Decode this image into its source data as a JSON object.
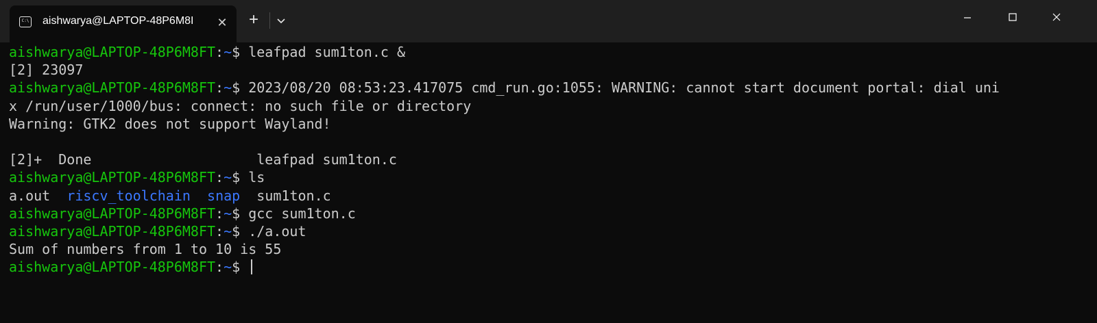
{
  "window": {
    "tab_title": "aishwarya@LAPTOP-48P6M8I",
    "tab_icon": "terminal-icon",
    "new_tab_icon": "plus-icon",
    "dropdown_icon": "chevron-down-icon",
    "minimize_icon": "minimize-icon",
    "maximize_icon": "maximize-icon",
    "close_icon": "close-icon"
  },
  "colors": {
    "background": "#0c0c0c",
    "titlebar": "#1f1f1f",
    "prompt_user": "#16c60c",
    "prompt_path": "#3b78ff",
    "text": "#cccccc"
  },
  "terminal": {
    "prompt": {
      "user": "aishwarya@LAPTOP-48P6M8FT",
      "colon": ":",
      "path": "~",
      "symbol": "$ "
    },
    "lines": {
      "l1_cmd": "leafpad sum1ton.c &",
      "l2": "[2] 23097",
      "l3_cmd": "2023/08/20 08:53:23.417075 cmd_run.go:1055: WARNING: cannot start document portal: dial uni",
      "l4": "x /run/user/1000/bus: connect: no such file or directory",
      "l5": "Warning: GTK2 does not support Wayland!",
      "l6": "",
      "l7": "[2]+  Done                    leafpad sum1ton.c",
      "l8_cmd": "ls",
      "l9_items": [
        "a.out",
        "riscv_toolchain",
        "snap",
        "sum1ton.c"
      ],
      "l10_cmd": "gcc sum1ton.c",
      "l11_cmd": "./a.out",
      "l12": "Sum of numbers from 1 to 10 is 55",
      "l13_cmd": ""
    }
  }
}
